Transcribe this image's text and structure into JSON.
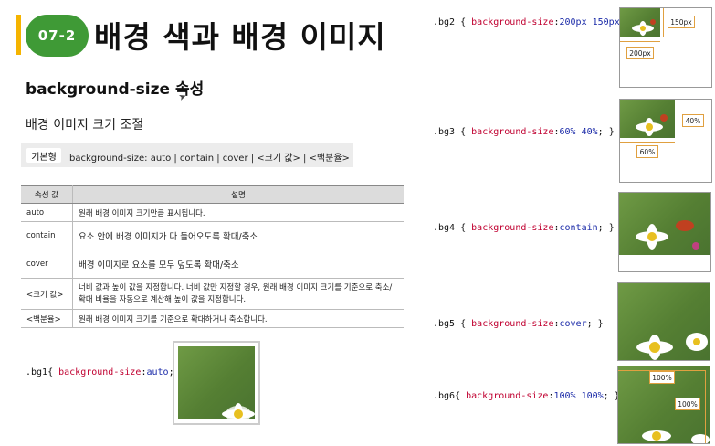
{
  "header": {
    "chapter_number": "07-2",
    "chapter_title": "배경 색과 배경 이미지"
  },
  "section": {
    "heading": "background-size 속성",
    "subheading": "배경 이미지 크기 조절"
  },
  "syntax": {
    "tag": "기본형",
    "text": "background-size: auto | contain | cover | <크기 값> | <백분율>"
  },
  "table": {
    "headers": [
      "속성 값",
      "설명"
    ],
    "rows": [
      {
        "value": "auto",
        "desc": "원래 배경 이미지 크기만큼 표시됩니다."
      },
      {
        "value": "contain",
        "desc": "요소 안에 배경 이미지가 다 들어오도록  확대/축소"
      },
      {
        "value": "cover",
        "desc": "배경 이미지로 요소를 모두 덮도록  확대/축소"
      },
      {
        "value": "<크기 값>",
        "desc": "너비 값과 높이 값을 지정합니다. 너비 값만 지정할 경우, 원래 배경 이미지 크기를 기준으로 축소/확대 비율을 자동으로 계산해 높이 값을 지정합니다."
      },
      {
        "value": "<백분율>",
        "desc": "원래 배경 이미지 크기를 기준으로 확대하거나 축소합니다."
      }
    ]
  },
  "examples": {
    "bg1": {
      "selector": ".bg1{ ",
      "prop": "background-size",
      "value": "auto",
      "end": ";}"
    },
    "bg2": {
      "selector": ".bg2 { ",
      "prop": "background-size",
      "value": "200px 150px",
      "end": ";}",
      "label_w": "200px",
      "label_h": "150px"
    },
    "bg3": {
      "selector": ".bg3 { ",
      "prop": "background-size",
      "value": "60% 40%",
      "end": "; }",
      "label_w": "60%",
      "label_h": "40%"
    },
    "bg4": {
      "selector": ".bg4 { ",
      "prop": "background-size",
      "value": "contain",
      "end": "; }"
    },
    "bg5": {
      "selector": ".bg5 { ",
      "prop": "background-size",
      "value": "cover",
      "end": "; }"
    },
    "bg6": {
      "selector": ".bg6{ ",
      "prop": "background-size",
      "value": "100% 100%",
      "end": "; }",
      "label_w": "100%",
      "label_h": "100%"
    }
  },
  "colors": {
    "accent_yellow": "#f5b400",
    "badge_green": "#3f9a36",
    "property_red": "#c00030",
    "value_blue": "#1a2aa8"
  }
}
